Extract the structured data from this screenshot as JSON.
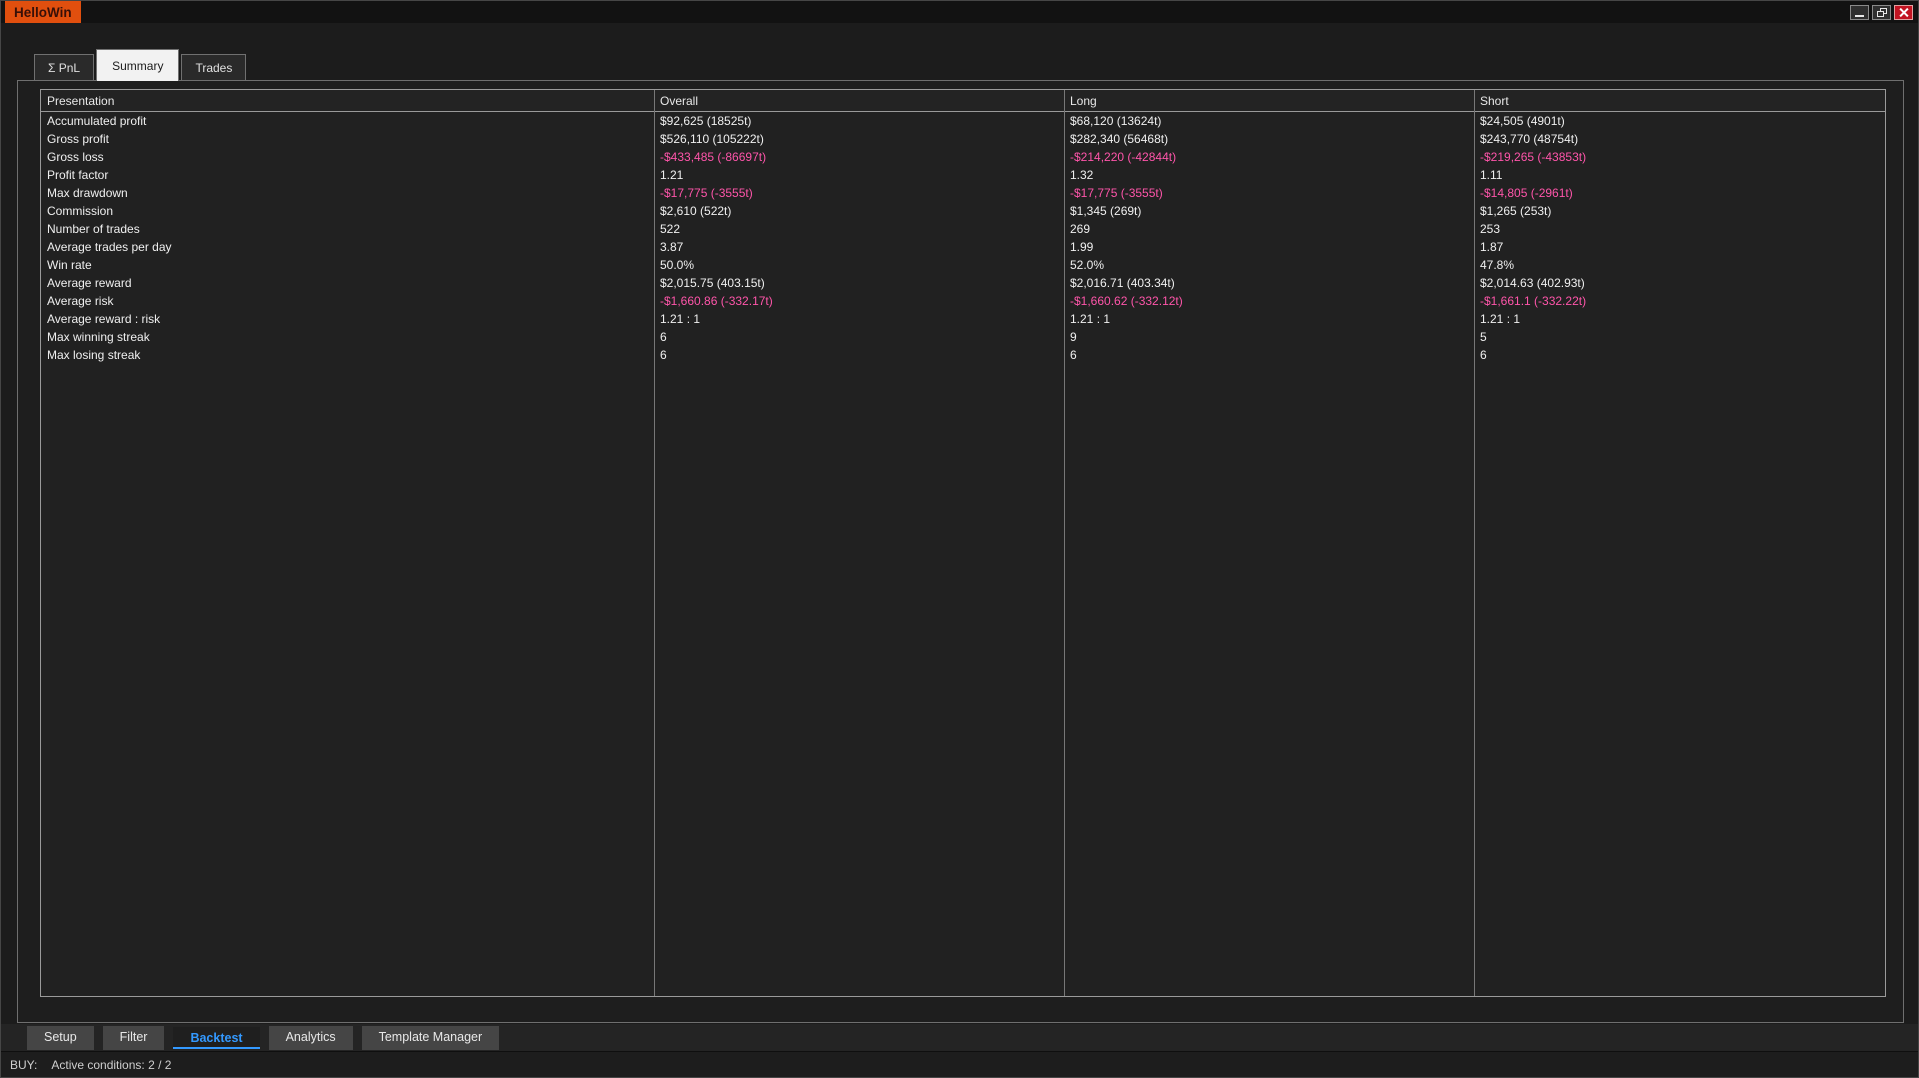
{
  "window": {
    "title": "HelloWin",
    "controls": {
      "minimize": "minimize",
      "restore": "restore",
      "close": "close"
    }
  },
  "top_tabs": [
    {
      "label": "Σ PnL",
      "active": false
    },
    {
      "label": "Summary",
      "active": true
    },
    {
      "label": "Trades",
      "active": false
    }
  ],
  "table": {
    "columns": [
      "Presentation",
      "Overall",
      "Long",
      "Short"
    ],
    "rows": [
      {
        "label": "Accumulated profit",
        "overall": "$92,625 (18525t)",
        "long": "$68,120 (13624t)",
        "short": "$24,505 (4901t)",
        "negative": false
      },
      {
        "label": "Gross profit",
        "overall": "$526,110 (105222t)",
        "long": "$282,340 (56468t)",
        "short": "$243,770 (48754t)",
        "negative": false
      },
      {
        "label": "Gross loss",
        "overall": "-$433,485 (-86697t)",
        "long": "-$214,220 (-42844t)",
        "short": "-$219,265 (-43853t)",
        "negative": true
      },
      {
        "label": "Profit factor",
        "overall": "1.21",
        "long": "1.32",
        "short": "1.11",
        "negative": false
      },
      {
        "label": "Max drawdown",
        "overall": "-$17,775 (-3555t)",
        "long": "-$17,775 (-3555t)",
        "short": "-$14,805 (-2961t)",
        "negative": true
      },
      {
        "label": "Commission",
        "overall": "$2,610 (522t)",
        "long": "$1,345 (269t)",
        "short": "$1,265 (253t)",
        "negative": false
      },
      {
        "label": "Number of trades",
        "overall": "522",
        "long": "269",
        "short": "253",
        "negative": false
      },
      {
        "label": "Average trades per day",
        "overall": "3.87",
        "long": "1.99",
        "short": "1.87",
        "negative": false
      },
      {
        "label": "Win rate",
        "overall": "50.0%",
        "long": "52.0%",
        "short": "47.8%",
        "negative": false
      },
      {
        "label": "Average reward",
        "overall": "$2,015.75 (403.15t)",
        "long": "$2,016.71 (403.34t)",
        "short": "$2,014.63 (402.93t)",
        "negative": false
      },
      {
        "label": "Average risk",
        "overall": "-$1,660.86 (-332.17t)",
        "long": "-$1,660.62 (-332.12t)",
        "short": "-$1,661.1 (-332.22t)",
        "negative": true
      },
      {
        "label": "Average reward : risk",
        "overall": "1.21 : 1",
        "long": "1.21 : 1",
        "short": "1.21 : 1",
        "negative": false
      },
      {
        "label": "Max winning streak",
        "overall": "6",
        "long": "9",
        "short": "5",
        "negative": false
      },
      {
        "label": "Max losing streak",
        "overall": "6",
        "long": "6",
        "short": "6",
        "negative": false
      }
    ]
  },
  "bottom_tabs": [
    {
      "label": "Setup",
      "active": false
    },
    {
      "label": "Filter",
      "active": false
    },
    {
      "label": "Backtest",
      "active": true
    },
    {
      "label": "Analytics",
      "active": false
    },
    {
      "label": "Template Manager",
      "active": false
    }
  ],
  "status_bar": {
    "prefix": "BUY:",
    "text": "Active conditions: 2 / 2"
  },
  "colors": {
    "negative": "#ff55aa",
    "active_tab_blue": "#3399ff",
    "brand_orange": "#e14f0e"
  }
}
